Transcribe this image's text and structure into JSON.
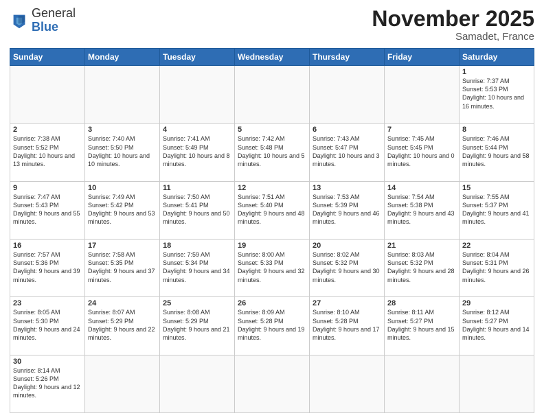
{
  "header": {
    "logo_line1": "General",
    "logo_line2": "Blue",
    "month": "November 2025",
    "location": "Samadet, France"
  },
  "weekdays": [
    "Sunday",
    "Monday",
    "Tuesday",
    "Wednesday",
    "Thursday",
    "Friday",
    "Saturday"
  ],
  "weeks": [
    [
      {
        "day": "",
        "info": ""
      },
      {
        "day": "",
        "info": ""
      },
      {
        "day": "",
        "info": ""
      },
      {
        "day": "",
        "info": ""
      },
      {
        "day": "",
        "info": ""
      },
      {
        "day": "",
        "info": ""
      },
      {
        "day": "1",
        "info": "Sunrise: 7:37 AM\nSunset: 5:53 PM\nDaylight: 10 hours\nand 16 minutes."
      }
    ],
    [
      {
        "day": "2",
        "info": "Sunrise: 7:38 AM\nSunset: 5:52 PM\nDaylight: 10 hours\nand 13 minutes."
      },
      {
        "day": "3",
        "info": "Sunrise: 7:40 AM\nSunset: 5:50 PM\nDaylight: 10 hours\nand 10 minutes."
      },
      {
        "day": "4",
        "info": "Sunrise: 7:41 AM\nSunset: 5:49 PM\nDaylight: 10 hours\nand 8 minutes."
      },
      {
        "day": "5",
        "info": "Sunrise: 7:42 AM\nSunset: 5:48 PM\nDaylight: 10 hours\nand 5 minutes."
      },
      {
        "day": "6",
        "info": "Sunrise: 7:43 AM\nSunset: 5:47 PM\nDaylight: 10 hours\nand 3 minutes."
      },
      {
        "day": "7",
        "info": "Sunrise: 7:45 AM\nSunset: 5:45 PM\nDaylight: 10 hours\nand 0 minutes."
      },
      {
        "day": "8",
        "info": "Sunrise: 7:46 AM\nSunset: 5:44 PM\nDaylight: 9 hours\nand 58 minutes."
      }
    ],
    [
      {
        "day": "9",
        "info": "Sunrise: 7:47 AM\nSunset: 5:43 PM\nDaylight: 9 hours\nand 55 minutes."
      },
      {
        "day": "10",
        "info": "Sunrise: 7:49 AM\nSunset: 5:42 PM\nDaylight: 9 hours\nand 53 minutes."
      },
      {
        "day": "11",
        "info": "Sunrise: 7:50 AM\nSunset: 5:41 PM\nDaylight: 9 hours\nand 50 minutes."
      },
      {
        "day": "12",
        "info": "Sunrise: 7:51 AM\nSunset: 5:40 PM\nDaylight: 9 hours\nand 48 minutes."
      },
      {
        "day": "13",
        "info": "Sunrise: 7:53 AM\nSunset: 5:39 PM\nDaylight: 9 hours\nand 46 minutes."
      },
      {
        "day": "14",
        "info": "Sunrise: 7:54 AM\nSunset: 5:38 PM\nDaylight: 9 hours\nand 43 minutes."
      },
      {
        "day": "15",
        "info": "Sunrise: 7:55 AM\nSunset: 5:37 PM\nDaylight: 9 hours\nand 41 minutes."
      }
    ],
    [
      {
        "day": "16",
        "info": "Sunrise: 7:57 AM\nSunset: 5:36 PM\nDaylight: 9 hours\nand 39 minutes."
      },
      {
        "day": "17",
        "info": "Sunrise: 7:58 AM\nSunset: 5:35 PM\nDaylight: 9 hours\nand 37 minutes."
      },
      {
        "day": "18",
        "info": "Sunrise: 7:59 AM\nSunset: 5:34 PM\nDaylight: 9 hours\nand 34 minutes."
      },
      {
        "day": "19",
        "info": "Sunrise: 8:00 AM\nSunset: 5:33 PM\nDaylight: 9 hours\nand 32 minutes."
      },
      {
        "day": "20",
        "info": "Sunrise: 8:02 AM\nSunset: 5:32 PM\nDaylight: 9 hours\nand 30 minutes."
      },
      {
        "day": "21",
        "info": "Sunrise: 8:03 AM\nSunset: 5:32 PM\nDaylight: 9 hours\nand 28 minutes."
      },
      {
        "day": "22",
        "info": "Sunrise: 8:04 AM\nSunset: 5:31 PM\nDaylight: 9 hours\nand 26 minutes."
      }
    ],
    [
      {
        "day": "23",
        "info": "Sunrise: 8:05 AM\nSunset: 5:30 PM\nDaylight: 9 hours\nand 24 minutes."
      },
      {
        "day": "24",
        "info": "Sunrise: 8:07 AM\nSunset: 5:29 PM\nDaylight: 9 hours\nand 22 minutes."
      },
      {
        "day": "25",
        "info": "Sunrise: 8:08 AM\nSunset: 5:29 PM\nDaylight: 9 hours\nand 21 minutes."
      },
      {
        "day": "26",
        "info": "Sunrise: 8:09 AM\nSunset: 5:28 PM\nDaylight: 9 hours\nand 19 minutes."
      },
      {
        "day": "27",
        "info": "Sunrise: 8:10 AM\nSunset: 5:28 PM\nDaylight: 9 hours\nand 17 minutes."
      },
      {
        "day": "28",
        "info": "Sunrise: 8:11 AM\nSunset: 5:27 PM\nDaylight: 9 hours\nand 15 minutes."
      },
      {
        "day": "29",
        "info": "Sunrise: 8:12 AM\nSunset: 5:27 PM\nDaylight: 9 hours\nand 14 minutes."
      }
    ],
    [
      {
        "day": "30",
        "info": "Sunrise: 8:14 AM\nSunset: 5:26 PM\nDaylight: 9 hours\nand 12 minutes."
      },
      {
        "day": "",
        "info": ""
      },
      {
        "day": "",
        "info": ""
      },
      {
        "day": "",
        "info": ""
      },
      {
        "day": "",
        "info": ""
      },
      {
        "day": "",
        "info": ""
      },
      {
        "day": "",
        "info": ""
      }
    ]
  ]
}
